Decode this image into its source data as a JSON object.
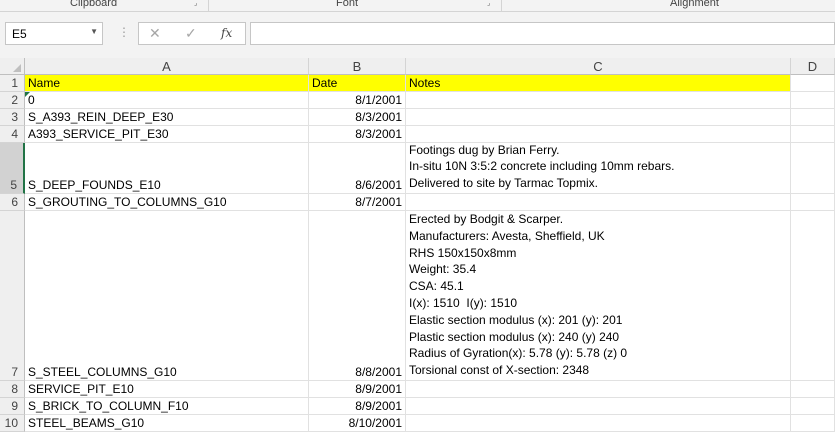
{
  "ribbon": {
    "groups": [
      "Clipboard",
      "Font",
      "Alignment"
    ]
  },
  "formula_bar": {
    "name_box": "E5",
    "cancel_glyph": "✕",
    "enter_glyph": "✓",
    "fx_label": "fx",
    "formula": ""
  },
  "columns": [
    "A",
    "B",
    "C",
    "D"
  ],
  "rows": [
    {
      "num": "1",
      "name": "Name",
      "date": "Date",
      "notes": [
        "Notes"
      ]
    },
    {
      "num": "2",
      "name": "0",
      "date": "8/1/2001",
      "notes": []
    },
    {
      "num": "3",
      "name": "S_A393_REIN_DEEP_E30",
      "date": "8/3/2001",
      "notes": []
    },
    {
      "num": "4",
      "name": "A393_SERVICE_PIT_E30",
      "date": "8/3/2001",
      "notes": []
    },
    {
      "num": "5",
      "name": "S_DEEP_FOUNDS_E10",
      "date": "8/6/2001",
      "notes": [
        "Footings dug by Brian Ferry.",
        "In-situ 10N 3:5:2 concrete including 10mm rebars.",
        "Delivered to site by Tarmac Topmix."
      ]
    },
    {
      "num": "6",
      "name": "S_GROUTING_TO_COLUMNS_G10",
      "date": "8/7/2001",
      "notes": []
    },
    {
      "num": "7",
      "name": "S_STEEL_COLUMNS_G10",
      "date": "8/8/2001",
      "notes": [
        "Erected by Bodgit & Scarper.",
        "Manufacturers: Avesta, Sheffield, UK",
        "RHS 150x150x8mm",
        "Weight: 35.4",
        "CSA: 45.1",
        "I(x): 1510  I(y): 1510",
        "Elastic section modulus (x): 201 (y): 201",
        "Plastic section modulus (x): 240 (y) 240",
        "Radius of Gyration(x): 5.78 (y): 5.78 (z) 0",
        "Torsional const of X-section: 2348"
      ]
    },
    {
      "num": "8",
      "name": "SERVICE_PIT_E10",
      "date": "8/9/2001",
      "notes": []
    },
    {
      "num": "9",
      "name": "S_BRICK_TO_COLUMN_F10",
      "date": "8/9/2001",
      "notes": []
    },
    {
      "num": "10",
      "name": "STEEL_BEAMS_G10",
      "date": "8/10/2001",
      "notes": []
    }
  ],
  "colors": {
    "header_fill": "#ffff00",
    "excel_green": "#217346"
  }
}
